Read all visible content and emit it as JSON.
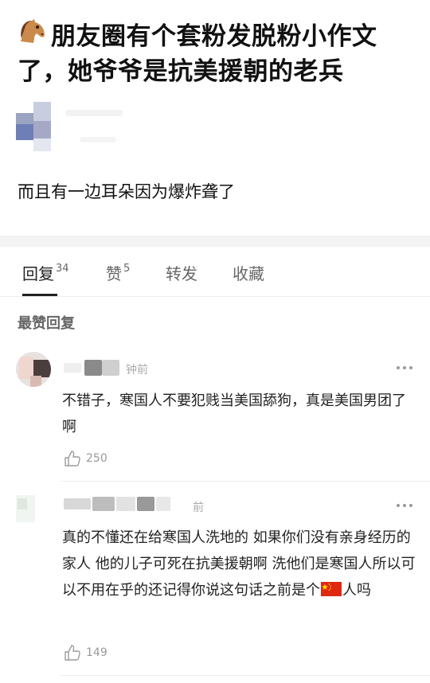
{
  "post": {
    "title": "朋友圈有个套粉发脱粉小作文了，她爷爷是抗美援朝的老兵",
    "title_icon": "horse-emoji-icon",
    "body": "而且有一边耳朵因为爆炸聋了"
  },
  "tabs": [
    {
      "label": "回复",
      "count": "34"
    },
    {
      "label": "赞",
      "count": "5"
    },
    {
      "label": "转发"
    },
    {
      "label": "收藏"
    }
  ],
  "section_heading": "最赞回复",
  "comments": [
    {
      "time_fragment": "钟前",
      "text": "不错子，寒国人不要犯贱当美国舔狗，真是美国男团了啊",
      "likes": "250"
    },
    {
      "time_fragment": "前",
      "text_before_flag": "真的不懂还在给寒国人洗地的 如果你们没有亲身经历的家人 他的儿子可死在抗美援朝啊 洗他们是寒国人所以可以不用在乎的还记得你说这句话之前是个",
      "flag_icon": "china-flag-icon",
      "text_after_flag": "人吗",
      "likes": "149"
    }
  ],
  "colors": {
    "text": "#111111",
    "muted": "#999999",
    "divider": "#f3f3f3",
    "flag_red": "#de2910",
    "flag_star": "#ffde00"
  }
}
